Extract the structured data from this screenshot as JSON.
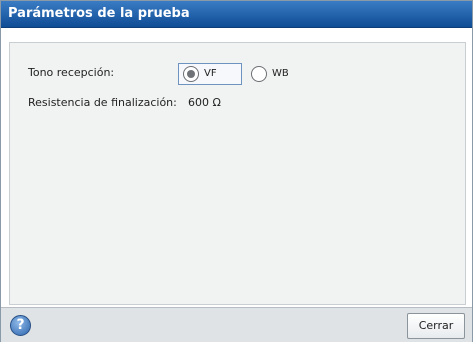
{
  "window": {
    "title": "Parámetros de la prueba"
  },
  "settings": {
    "tone_label": "Tono recepción:",
    "tone_options": [
      {
        "label": "VF",
        "selected": true
      },
      {
        "label": "WB",
        "selected": false
      }
    ],
    "termination_label": "Resistencia de finalización:",
    "termination_value": "600 Ω"
  },
  "footer": {
    "help_icon": "question-mark-icon",
    "help_glyph": "?",
    "close_label": "Cerrar"
  },
  "colors": {
    "titlebar": "#1b5aa3",
    "content_bg": "#f1f2f2",
    "footer_bg": "#dfe3e6"
  }
}
